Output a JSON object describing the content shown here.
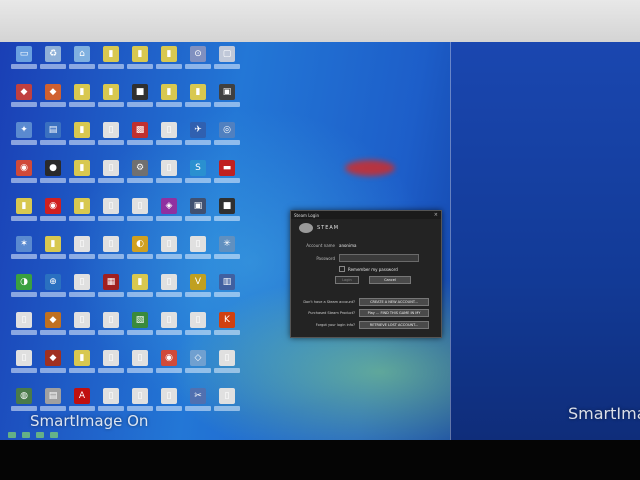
{
  "desktop": {
    "icons": [
      {
        "name": "computer-icon",
        "color": "#6aa0e0",
        "glyph": "▭"
      },
      {
        "name": "recycle-bin-icon",
        "color": "#8fb0d8",
        "glyph": "♻"
      },
      {
        "name": "network-icon",
        "color": "#7fb0e0",
        "glyph": "⌂"
      },
      {
        "name": "folder-icon",
        "color": "#d8c850",
        "glyph": "▮"
      },
      {
        "name": "folder-icon",
        "color": "#d8c850",
        "glyph": "▮"
      },
      {
        "name": "folder-icon",
        "color": "#d8c850",
        "glyph": "▮"
      },
      {
        "name": "shortcut-icon",
        "color": "#8090c0",
        "glyph": "⊙"
      },
      {
        "name": "shortcut-icon",
        "color": "#c0c8d8",
        "glyph": "▢"
      },
      {
        "name": "program-icon",
        "color": "#c04040",
        "glyph": "◆"
      },
      {
        "name": "program-icon",
        "color": "#d06030",
        "glyph": "◆"
      },
      {
        "name": "folder-icon",
        "color": "#d8c850",
        "glyph": "▮"
      },
      {
        "name": "folder-icon",
        "color": "#d8c850",
        "glyph": "▮"
      },
      {
        "name": "program-icon",
        "color": "#303030",
        "glyph": "■"
      },
      {
        "name": "folder-icon",
        "color": "#d8c850",
        "glyph": "▮"
      },
      {
        "name": "folder-icon",
        "color": "#d8c850",
        "glyph": "▮"
      },
      {
        "name": "program-icon",
        "color": "#404040",
        "glyph": "▣"
      },
      {
        "name": "program-icon",
        "color": "#5a8ad0",
        "glyph": "✦"
      },
      {
        "name": "program-icon",
        "color": "#3a70c0",
        "glyph": "▤"
      },
      {
        "name": "folder-icon",
        "color": "#d8c850",
        "glyph": "▮"
      },
      {
        "name": "document-icon",
        "color": "#e0e0e0",
        "glyph": "▯"
      },
      {
        "name": "program-icon",
        "color": "#c03030",
        "glyph": "▩"
      },
      {
        "name": "document-icon",
        "color": "#e0e0e0",
        "glyph": "▯"
      },
      {
        "name": "program-icon",
        "color": "#3060b0",
        "glyph": "✈"
      },
      {
        "name": "program-icon",
        "color": "#5080c0",
        "glyph": "◎"
      },
      {
        "name": "chrome-icon",
        "color": "#d04a3a",
        "glyph": "◉"
      },
      {
        "name": "program-icon",
        "color": "#2a2a2a",
        "glyph": "●"
      },
      {
        "name": "folder-icon",
        "color": "#d8c850",
        "glyph": "▮"
      },
      {
        "name": "document-icon",
        "color": "#e0e0e0",
        "glyph": "▯"
      },
      {
        "name": "gear-icon",
        "color": "#707070",
        "glyph": "⚙"
      },
      {
        "name": "document-icon",
        "color": "#e0e0e0",
        "glyph": "▯"
      },
      {
        "name": "skype-icon",
        "color": "#2a90d0",
        "glyph": "S"
      },
      {
        "name": "program-icon",
        "color": "#c02020",
        "glyph": "▬"
      },
      {
        "name": "folder-icon",
        "color": "#d8c850",
        "glyph": "▮"
      },
      {
        "name": "program-icon",
        "color": "#d02020",
        "glyph": "◉"
      },
      {
        "name": "folder-icon",
        "color": "#d8c850",
        "glyph": "▮"
      },
      {
        "name": "document-icon",
        "color": "#e0e0e0",
        "glyph": "▯"
      },
      {
        "name": "document-icon",
        "color": "#e0e0e0",
        "glyph": "▯"
      },
      {
        "name": "program-icon",
        "color": "#9030a0",
        "glyph": "◈"
      },
      {
        "name": "program-icon",
        "color": "#405070",
        "glyph": "▣"
      },
      {
        "name": "program-icon",
        "color": "#303030",
        "glyph": "■"
      },
      {
        "name": "program-icon",
        "color": "#5a8ad0",
        "glyph": "✶"
      },
      {
        "name": "folder-icon",
        "color": "#d8c850",
        "glyph": "▮"
      },
      {
        "name": "document-icon",
        "color": "#e0e0e0",
        "glyph": "▯"
      },
      {
        "name": "document-icon",
        "color": "#e0e0e0",
        "glyph": "▯"
      },
      {
        "name": "program-icon",
        "color": "#d0a020",
        "glyph": "◐"
      },
      {
        "name": "document-icon",
        "color": "#e0e0e0",
        "glyph": "▯"
      },
      {
        "name": "document-icon",
        "color": "#e0e0e0",
        "glyph": "▯"
      },
      {
        "name": "program-icon",
        "color": "#6090c0",
        "glyph": "✳"
      },
      {
        "name": "program-icon",
        "color": "#3aa040",
        "glyph": "◑"
      },
      {
        "name": "program-icon",
        "color": "#2a70c0",
        "glyph": "⊕"
      },
      {
        "name": "document-icon",
        "color": "#e0e0e0",
        "glyph": "▯"
      },
      {
        "name": "program-icon",
        "color": "#a02020",
        "glyph": "▦"
      },
      {
        "name": "folder-icon",
        "color": "#d8c850",
        "glyph": "▮"
      },
      {
        "name": "document-icon",
        "color": "#e0e0e0",
        "glyph": "▯"
      },
      {
        "name": "program-icon",
        "color": "#c0a020",
        "glyph": "V"
      },
      {
        "name": "program-icon",
        "color": "#4060a0",
        "glyph": "▥"
      },
      {
        "name": "document-icon",
        "color": "#e0e0e0",
        "glyph": "▯"
      },
      {
        "name": "program-icon",
        "color": "#c07020",
        "glyph": "◆"
      },
      {
        "name": "document-icon",
        "color": "#e0e0e0",
        "glyph": "▯"
      },
      {
        "name": "document-icon",
        "color": "#e0e0e0",
        "glyph": "▯"
      },
      {
        "name": "program-icon",
        "color": "#3a8a3a",
        "glyph": "▧"
      },
      {
        "name": "document-icon",
        "color": "#e0e0e0",
        "glyph": "▯"
      },
      {
        "name": "document-icon",
        "color": "#e0e0e0",
        "glyph": "▯"
      },
      {
        "name": "program-icon",
        "color": "#d04010",
        "glyph": "K"
      },
      {
        "name": "document-icon",
        "color": "#e0e0e0",
        "glyph": "▯"
      },
      {
        "name": "program-icon",
        "color": "#a03020",
        "glyph": "◆"
      },
      {
        "name": "folder-icon",
        "color": "#d8c850",
        "glyph": "▮"
      },
      {
        "name": "document-icon",
        "color": "#e0e0e0",
        "glyph": "▯"
      },
      {
        "name": "document-icon",
        "color": "#e0e0e0",
        "glyph": "▯"
      },
      {
        "name": "chrome-icon",
        "color": "#d04a3a",
        "glyph": "◉"
      },
      {
        "name": "program-icon",
        "color": "#70a0d0",
        "glyph": "◇"
      },
      {
        "name": "document-icon",
        "color": "#e0e0e0",
        "glyph": "▯"
      },
      {
        "name": "program-icon",
        "color": "#4a7a4a",
        "glyph": "◍"
      },
      {
        "name": "program-icon",
        "color": "#a0a0a0",
        "glyph": "▤"
      },
      {
        "name": "adobe-reader-icon",
        "color": "#c01010",
        "glyph": "A"
      },
      {
        "name": "document-icon",
        "color": "#e0e0e0",
        "glyph": "▯"
      },
      {
        "name": "document-icon",
        "color": "#e0e0e0",
        "glyph": "▯"
      },
      {
        "name": "document-icon",
        "color": "#e0e0e0",
        "glyph": "▯"
      },
      {
        "name": "program-icon",
        "color": "#5070b0",
        "glyph": "✂"
      },
      {
        "name": "document-icon",
        "color": "#e0e0e0",
        "glyph": "▯"
      }
    ]
  },
  "watermark": {
    "left": "SmartImage On",
    "right": "SmartIma"
  },
  "steam_login": {
    "title": "Steam Login",
    "close": "×",
    "logo_text": "STEAM",
    "account_label": "Account name",
    "account_value": "anonima",
    "password_label": "Password",
    "password_value": "",
    "remember_label": "Remember my password",
    "login_button": "Login",
    "cancel_button": "Cancel",
    "create_prompt": "Don't have a Steam account?",
    "create_button": "CREATE A NEW ACCOUNT...",
    "cd_prompt": "Purchased Steam Product?",
    "cd_button": "Play ... FIND THIS GAME IN MY",
    "forgot_prompt": "Forgot your login info?",
    "forgot_button": "RETRIEVE LOST ACCOUNT..."
  }
}
